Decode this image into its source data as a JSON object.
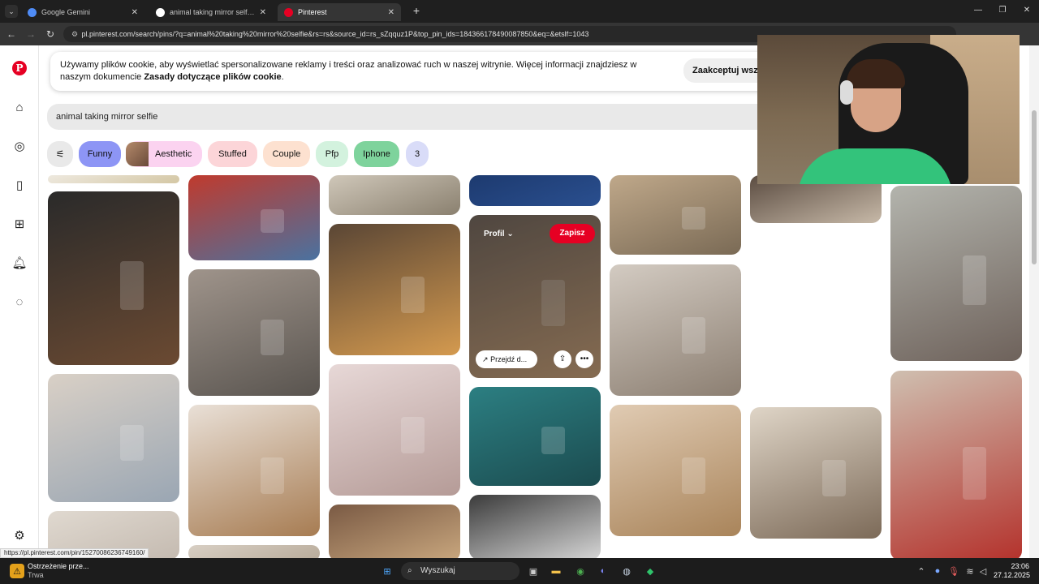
{
  "browser": {
    "tabs": [
      {
        "title": "Google Gemini",
        "favicon_color": "#4f8cf6",
        "active": false
      },
      {
        "title": "animal taking mirror selfie - Szu",
        "favicon_color": "#ffffff",
        "active": false
      },
      {
        "title": "Pinterest",
        "favicon_color": "#e60023",
        "active": true
      }
    ],
    "new_tab_label": "+",
    "url": "pl.pinterest.com/search/pins/?q=animal%20taking%20mirror%20selfie&rs=rs&source_id=rs_sZqquz1P&top_pin_ids=184366178490087850&eq=&etslf=1043"
  },
  "cookie_banner": {
    "text_line1": "Używamy plików cookie, aby wyświetlać spersonalizowane reklamy i treści oraz analizować ruch w naszej witrynie. Więcej informacji znajdziesz w",
    "text_line2_prefix": "naszym dokumencie ",
    "text_line2_link": "Zasady dotyczące plików cookie",
    "text_line2_suffix": ".",
    "accept_button": "Zaakceptuj wszy"
  },
  "search": {
    "value": "animal taking mirror selfie"
  },
  "filter_chips": [
    {
      "label": "Funny",
      "color": "#8d95f5",
      "has_thumb": false
    },
    {
      "label": "Aesthetic",
      "color": "#fbd3f0",
      "has_thumb": true
    },
    {
      "label": "Stuffed",
      "color": "#fcd5d8",
      "has_thumb": false
    },
    {
      "label": "Couple",
      "color": "#fde1d0",
      "has_thumb": false
    },
    {
      "label": "Pfp",
      "color": "#d3f2de",
      "has_thumb": false
    },
    {
      "label": "Iphone",
      "color": "#7ed39c",
      "has_thumb": false
    },
    {
      "label": "3",
      "color": "#d9dcf8",
      "has_thumb": false
    }
  ],
  "hover_pin": {
    "profile_label": "Profil",
    "save_label": "Zapisz",
    "goto_label": "Przejdź d..."
  },
  "pins": [
    {
      "name": "orangutan-plush",
      "c1": "#2a2a2a",
      "c2": "#6b4a32"
    },
    {
      "name": "cat-blue-hat",
      "c1": "#d9d0c6",
      "c2": "#9aa6b3"
    },
    {
      "name": "plush-partial",
      "c1": "#eee9df",
      "c2": "#d4c7a4"
    },
    {
      "name": "superman-figure",
      "c1": "#c03a2d",
      "c2": "#4a72a0"
    },
    {
      "name": "cats-mirror",
      "c1": "#9f948b",
      "c2": "#59544f"
    },
    {
      "name": "poodle-phone",
      "c1": "#e9e0d7",
      "c2": "#a77c52"
    },
    {
      "name": "top-partial-2",
      "c1": "#d8cfc4",
      "c2": "#b8ab9a"
    },
    {
      "name": "cat-kitten-top",
      "c1": "#cfc7b9",
      "c2": "#8a806f"
    },
    {
      "name": "ginger-cat-phone",
      "c1": "#5a4635",
      "c2": "#d49a4f"
    },
    {
      "name": "raccoon-bathroom",
      "c1": "#e7d8d7",
      "c2": "#b59b97"
    },
    {
      "name": "vintage-mirror",
      "c1": "#7a5a44",
      "c2": "#c9a77e"
    },
    {
      "name": "blue-top",
      "c1": "#1d3a6f",
      "c2": "#2a4f8f"
    },
    {
      "name": "cat-phone-hover",
      "c1": "#6e6259",
      "c2": "#b99571"
    },
    {
      "name": "gorilla-bathroom",
      "c1": "#2c7f82",
      "c2": "#1b4b4f"
    },
    {
      "name": "lamp-ceiling",
      "c1": "#3b3b3b",
      "c2": "#d6d6d6"
    },
    {
      "name": "muscle-selfie",
      "c1": "#bfa88a",
      "c2": "#7a6a55"
    },
    {
      "name": "monkey-mirror",
      "c1": "#d3cbc2",
      "c2": "#8c7f72"
    },
    {
      "name": "yorkie-phone",
      "c1": "#e0cbb3",
      "c2": "#a9845a"
    },
    {
      "name": "bathtub-top",
      "c1": "#5b4c41",
      "c2": "#c7b9a8"
    },
    {
      "name": "tabby-pink-phone",
      "c1": "#dfd5c7",
      "c2": "#7c6a58"
    },
    {
      "name": "man-mirror",
      "c1": "#b3b4ad",
      "c2": "#6e625b"
    },
    {
      "name": "horse-mask",
      "c1": "#cfbfb0",
      "c2": "#b4322c"
    },
    {
      "name": "bottom-partial",
      "c1": "#e0d9d0",
      "c2": "#c4bab0"
    }
  ],
  "status_bar_url": "https://pl.pinterest.com/pin/15270086236749160/",
  "taskbar": {
    "notification_title": "Ostrzeżenie prze...",
    "notification_sub": "Trwa",
    "search_label": "Wyszukaj",
    "time": "23:06",
    "date": "27.12.2025"
  }
}
